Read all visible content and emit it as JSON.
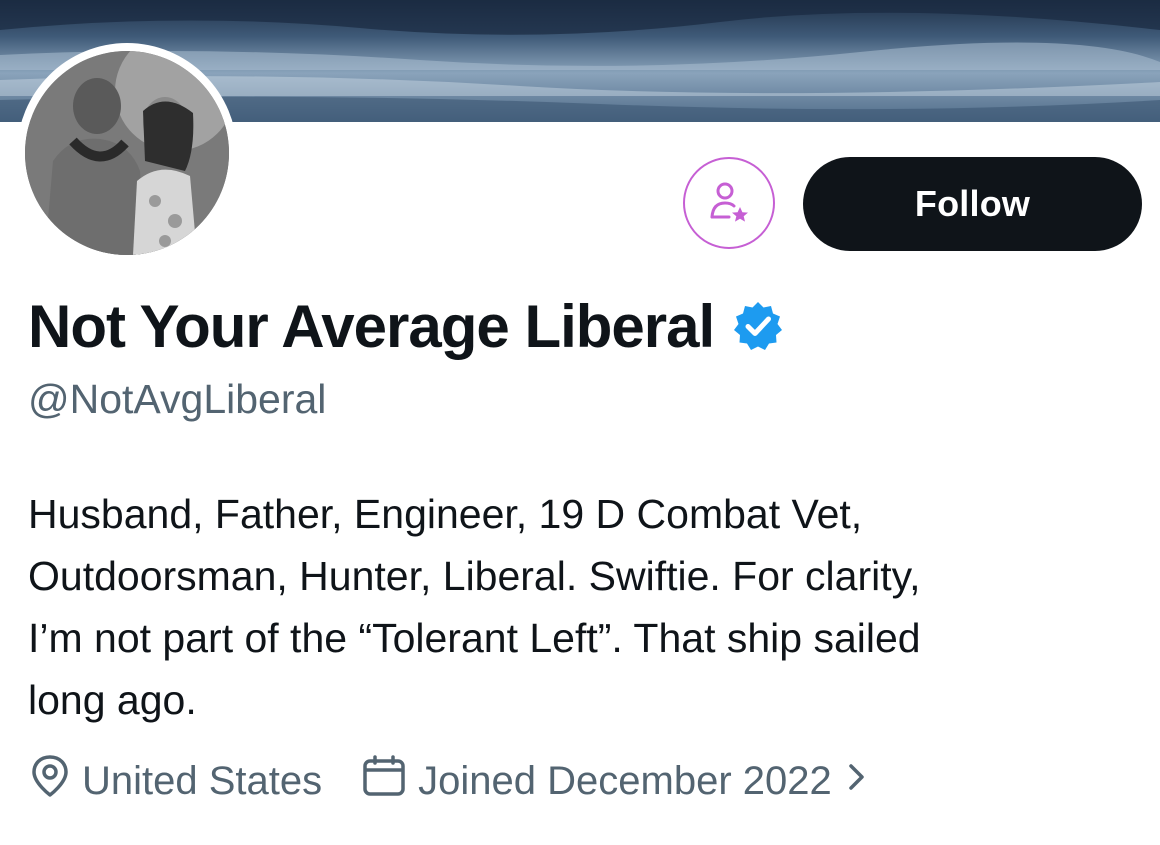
{
  "profile": {
    "display_name": "Not Your Average Liberal",
    "handle": "@NotAvgLiberal",
    "verified": true,
    "bio_lines": [
      "Husband, Father, Engineer, 19 D Combat Vet,",
      "Outdoorsman, Hunter, Liberal. Swiftie. For clarity,",
      "I’m not part of the “Tolerant Left”. That ship sailed",
      "long ago."
    ],
    "location": "United States",
    "joined": "Joined December 2022"
  },
  "actions": {
    "follow_label": "Follow",
    "subscribe_icon": "person-star-icon"
  },
  "icons": {
    "verified": "verified-badge-icon",
    "location": "location-pin-icon",
    "calendar": "calendar-icon",
    "chevron": "chevron-right-icon"
  },
  "colors": {
    "text_primary": "#0f1419",
    "text_secondary": "#536471",
    "follow_bg": "#0f1419",
    "verified_blue": "#1d9bf0",
    "subscribe_purple": "#c65fd4"
  }
}
